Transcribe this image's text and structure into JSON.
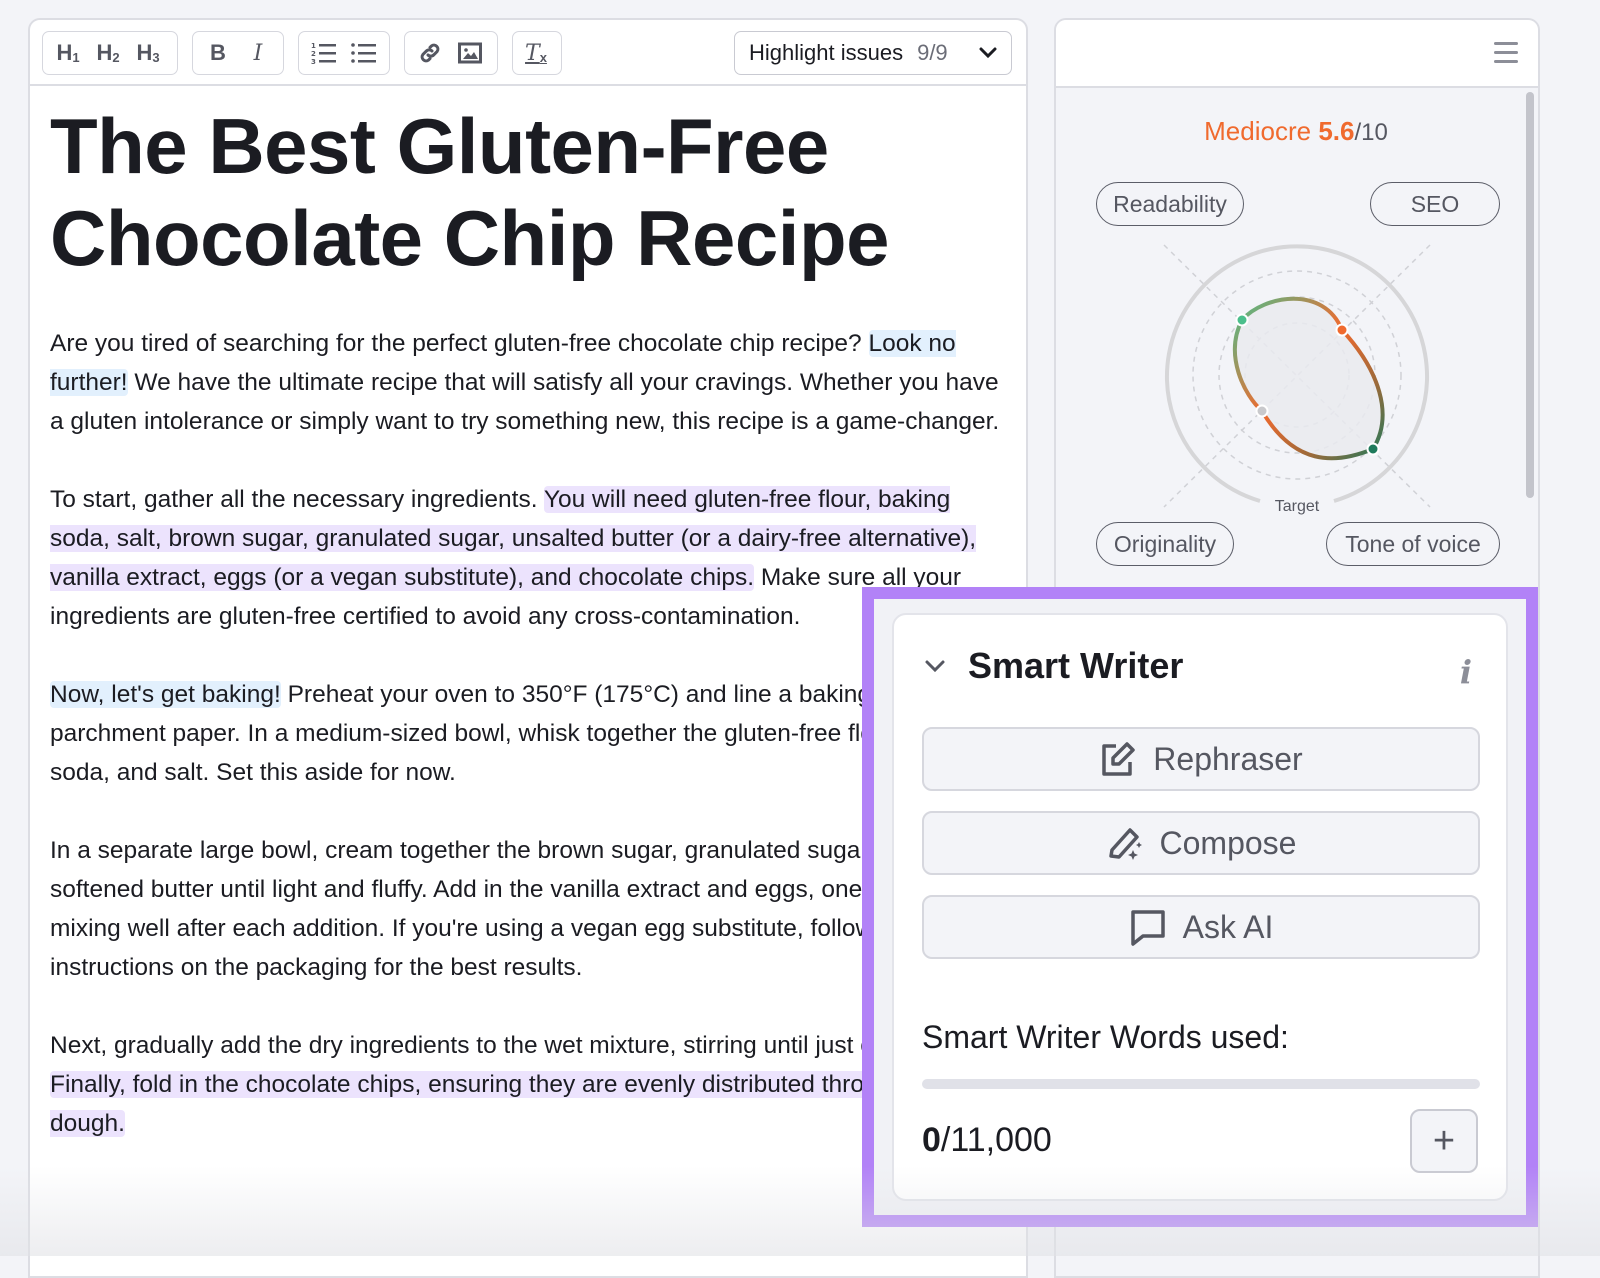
{
  "toolbar": {
    "heading_buttons": [
      {
        "label": "H",
        "sub": "1",
        "name": "h1"
      },
      {
        "label": "H",
        "sub": "2",
        "name": "h2"
      },
      {
        "label": "H",
        "sub": "3",
        "name": "h3"
      }
    ],
    "bold_label": "B",
    "italic_label": "I",
    "clear_format_label": "T",
    "clear_format_sub": "x",
    "highlight": {
      "label": "Highlight issues",
      "count": "9/9"
    }
  },
  "document": {
    "title": "The Best Gluten-Free Chocolate Chip Recipe",
    "paragraphs": [
      [
        {
          "text": "Are you tired of searching for the perfect gluten-free chocolate chip recipe? ",
          "hl": ""
        },
        {
          "text": "Look no further!",
          "hl": "blue"
        },
        {
          "text": " We have the ultimate recipe that will satisfy all your cravings. Whether you have a gluten intolerance or simply want to try something new, this recipe is a game-changer.",
          "hl": ""
        }
      ],
      [
        {
          "text": "To start, gather all the necessary ingredients. ",
          "hl": ""
        },
        {
          "text": "You will need gluten-free flour, baking soda, salt, brown sugar, granulated sugar, unsalted butter (or a dairy-free alternative), vanilla extract, eggs (or a vegan substitute), and chocolate chips.",
          "hl": "purple"
        },
        {
          "text": " Make sure all your ingredients are gluten-free certified to avoid any cross-contamination.",
          "hl": ""
        }
      ],
      [
        {
          "text": "Now, let's get baking!",
          "hl": "blue"
        },
        {
          "text": " Preheat your oven to 350°F (175°C) and line a baking sheet with parchment paper. In a medium-sized bowl, whisk together the gluten-free flour, baking soda, and salt. Set this aside for now.",
          "hl": ""
        }
      ],
      [
        {
          "text": "In a separate large bowl, cream together the brown sugar, granulated sugar, and softened butter until light and fluffy. Add in the vanilla extract and eggs, one at a time, mixing well after each addition. If you're using a vegan egg substitute, follow the instructions on the packaging for the best results.",
          "hl": ""
        }
      ],
      [
        {
          "text": "Next, gradually add the dry ingredients to the wet mixture, stirring until just combined. ",
          "hl": ""
        },
        {
          "text": "Finally, fold in the chocolate chips, ensuring they are evenly distributed throughout the dough.",
          "hl": "purple"
        }
      ]
    ]
  },
  "score": {
    "label": "Mediocre",
    "value": "5.6",
    "max": "/10",
    "color": "#f06a2e",
    "categories": [
      "Readability",
      "SEO",
      "Originality",
      "Tone of voice"
    ],
    "target_label": "Target"
  },
  "smart_writer": {
    "title": "Smart Writer",
    "info_label": "i",
    "buttons": [
      "Rephraser",
      "Compose",
      "Ask AI"
    ],
    "words_label": "Smart Writer Words used:",
    "words_used": "0",
    "words_total": "/11,000",
    "words_fraction": 0,
    "add_label": "+",
    "frame_color": "#b282f7"
  }
}
